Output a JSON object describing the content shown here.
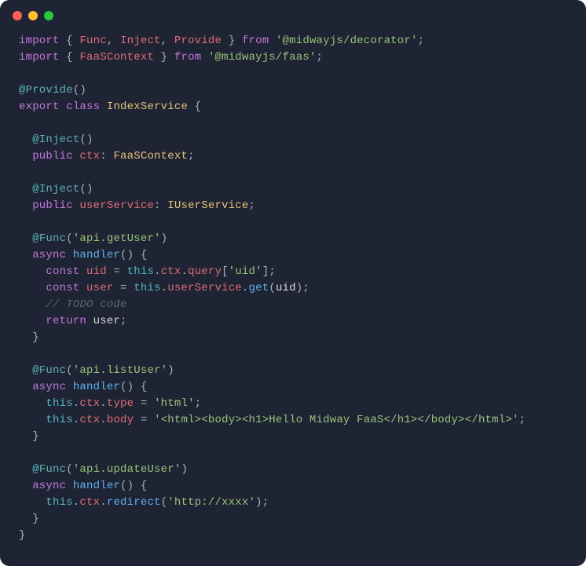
{
  "window": {
    "traffic_lights": [
      "close",
      "minimize",
      "zoom"
    ]
  },
  "code": {
    "lines": [
      "import { Func, Inject, Provide } from '@midwayjs/decorator';",
      "import { FaaSContext } from '@midwayjs/faas';",
      "",
      "@Provide()",
      "export class IndexService {",
      "",
      "  @Inject()",
      "  public ctx: FaaSContext;",
      "",
      "  @Inject()",
      "  public userService: IUserService;",
      "",
      "  @Func('api.getUser')",
      "  async handler() {",
      "    const uid = this.ctx.query['uid'];",
      "    const user = this.userService.get(uid);",
      "    // TODO code",
      "    return user;",
      "  }",
      "",
      "  @Func('api.listUser')",
      "  async handler() {",
      "    this.ctx.type = 'html';",
      "    this.ctx.body = '<html><body><h1>Hello Midway FaaS</h1></body></html>';",
      "  }",
      "",
      "  @Func('api.updateUser')",
      "  async handler() {",
      "    this.ctx.redirect('http://xxxx');",
      "  }",
      "}"
    ]
  },
  "tokens": {
    "import": "import",
    "from": "from",
    "export": "export",
    "class": "class",
    "public": "public",
    "async": "async",
    "const": "const",
    "return": "return",
    "this": "this",
    "Func": "Func",
    "Inject": "Inject",
    "Provide": "Provide",
    "FaaSContext": "FaaSContext",
    "IndexService": "IndexService",
    "ctx": "ctx",
    "userService": "userService",
    "IUserService": "IUserService",
    "handler": "handler",
    "uid": "uid",
    "user": "user",
    "query": "query",
    "get": "get",
    "type": "type",
    "body": "body",
    "redirect": "redirect",
    "str_decorator": "'@midwayjs/decorator'",
    "str_faas": "'@midwayjs/faas'",
    "str_getUser": "'api.getUser'",
    "str_listUser": "'api.listUser'",
    "str_updateUser": "'api.updateUser'",
    "str_uid": "'uid'",
    "str_html": "'html'",
    "str_body": "'<html><body><h1>Hello Midway FaaS</h1></body></html>'",
    "str_http": "'http://xxxx'",
    "comment_todo": "// TODO code"
  }
}
